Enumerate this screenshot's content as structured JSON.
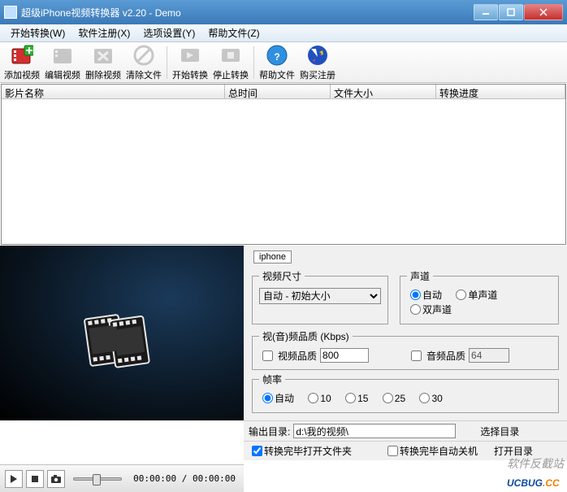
{
  "window": {
    "title": "超级iPhone视频转换器 v2.20 - Demo"
  },
  "menu": {
    "start": "开始转换(W)",
    "register": "软件注册(X)",
    "options": "选项设置(Y)",
    "help": "帮助文件(Z)"
  },
  "toolbar": {
    "add": "添加视频",
    "edit": "编辑视频",
    "delete": "删除视频",
    "clear": "清除文件",
    "start": "开始转换",
    "stop": "停止转换",
    "help": "帮助文件",
    "buy": "购买注册"
  },
  "columns": {
    "name": "影片名称",
    "duration": "总时间",
    "size": "文件大小",
    "progress": "转换进度"
  },
  "settings": {
    "tab": "iphone",
    "videoSize": {
      "legend": "视频尺寸",
      "value": "自动 - 初始大小"
    },
    "channel": {
      "legend": "声道",
      "auto": "自动",
      "mono": "单声道",
      "stereo": "双声道"
    },
    "quality": {
      "legend": "视(音)频品质 (Kbps)",
      "videoLabel": "视频品质",
      "videoVal": "800",
      "audioLabel": "音频品质",
      "audioVal": "64"
    },
    "fps": {
      "legend": "帧率",
      "auto": "自动",
      "o10": "10",
      "o15": "15",
      "o25": "25",
      "o30": "30"
    }
  },
  "output": {
    "label": "输出目录:",
    "path": "d:\\我的视频\\",
    "browse": "选择目录",
    "openFolder": "转换完毕打开文件夹",
    "shutdown": "转换完毕自动关机",
    "open": "打开目录"
  },
  "player": {
    "time": "00:00:00 / 00:00:00"
  },
  "watermark": {
    "sub": "软件反截站",
    "main_a": "UCBUG",
    "main_b": ".CC"
  }
}
